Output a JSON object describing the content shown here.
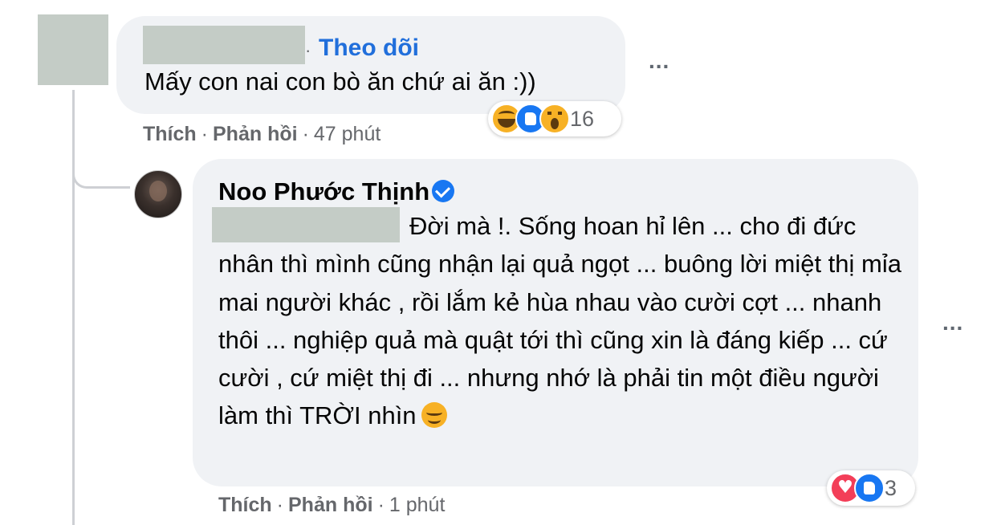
{
  "comment": {
    "follow_label": "Theo dõi",
    "text": "Mấy con nai con bò ăn chứ ai ăn :))",
    "reactions": {
      "icons": [
        "haha-icon",
        "like-icon",
        "wow-icon"
      ],
      "count": "16"
    },
    "actions": {
      "like_label": "Thích",
      "reply_label": "Phản hồi",
      "time": "47 phút"
    },
    "more_label": "..."
  },
  "reply": {
    "author_name": "Noo Phước Thịnh",
    "verified": true,
    "text": "Đời mà !. Sống hoan hỉ lên ... cho đi đức nhân thì mình cũng nhận lại quả ngọt ... buông lời miệt thị mỉa mai người khác , rồi lắm kẻ hùa nhau vào cười cợt ... nhanh thôi ... nghiệp quả mà quật tới thì cũng xin là đáng kiếp ... cứ cười , cứ miệt thị đi ... nhưng nhớ là phải tin một điều người làm thì TRỜI nhìn",
    "trailing_emoji": "smiling-face-icon",
    "reactions": {
      "icons": [
        "love-icon",
        "like-icon"
      ],
      "count": "3"
    },
    "actions": {
      "like_label": "Thích",
      "reply_label": "Phản hồi",
      "time": "1 phút"
    },
    "more_label": "..."
  },
  "colors": {
    "link_blue": "#216fdb",
    "bubble_bg": "#f0f2f5",
    "meta_gray": "#65676b",
    "redaction": "#c4ccc6"
  }
}
